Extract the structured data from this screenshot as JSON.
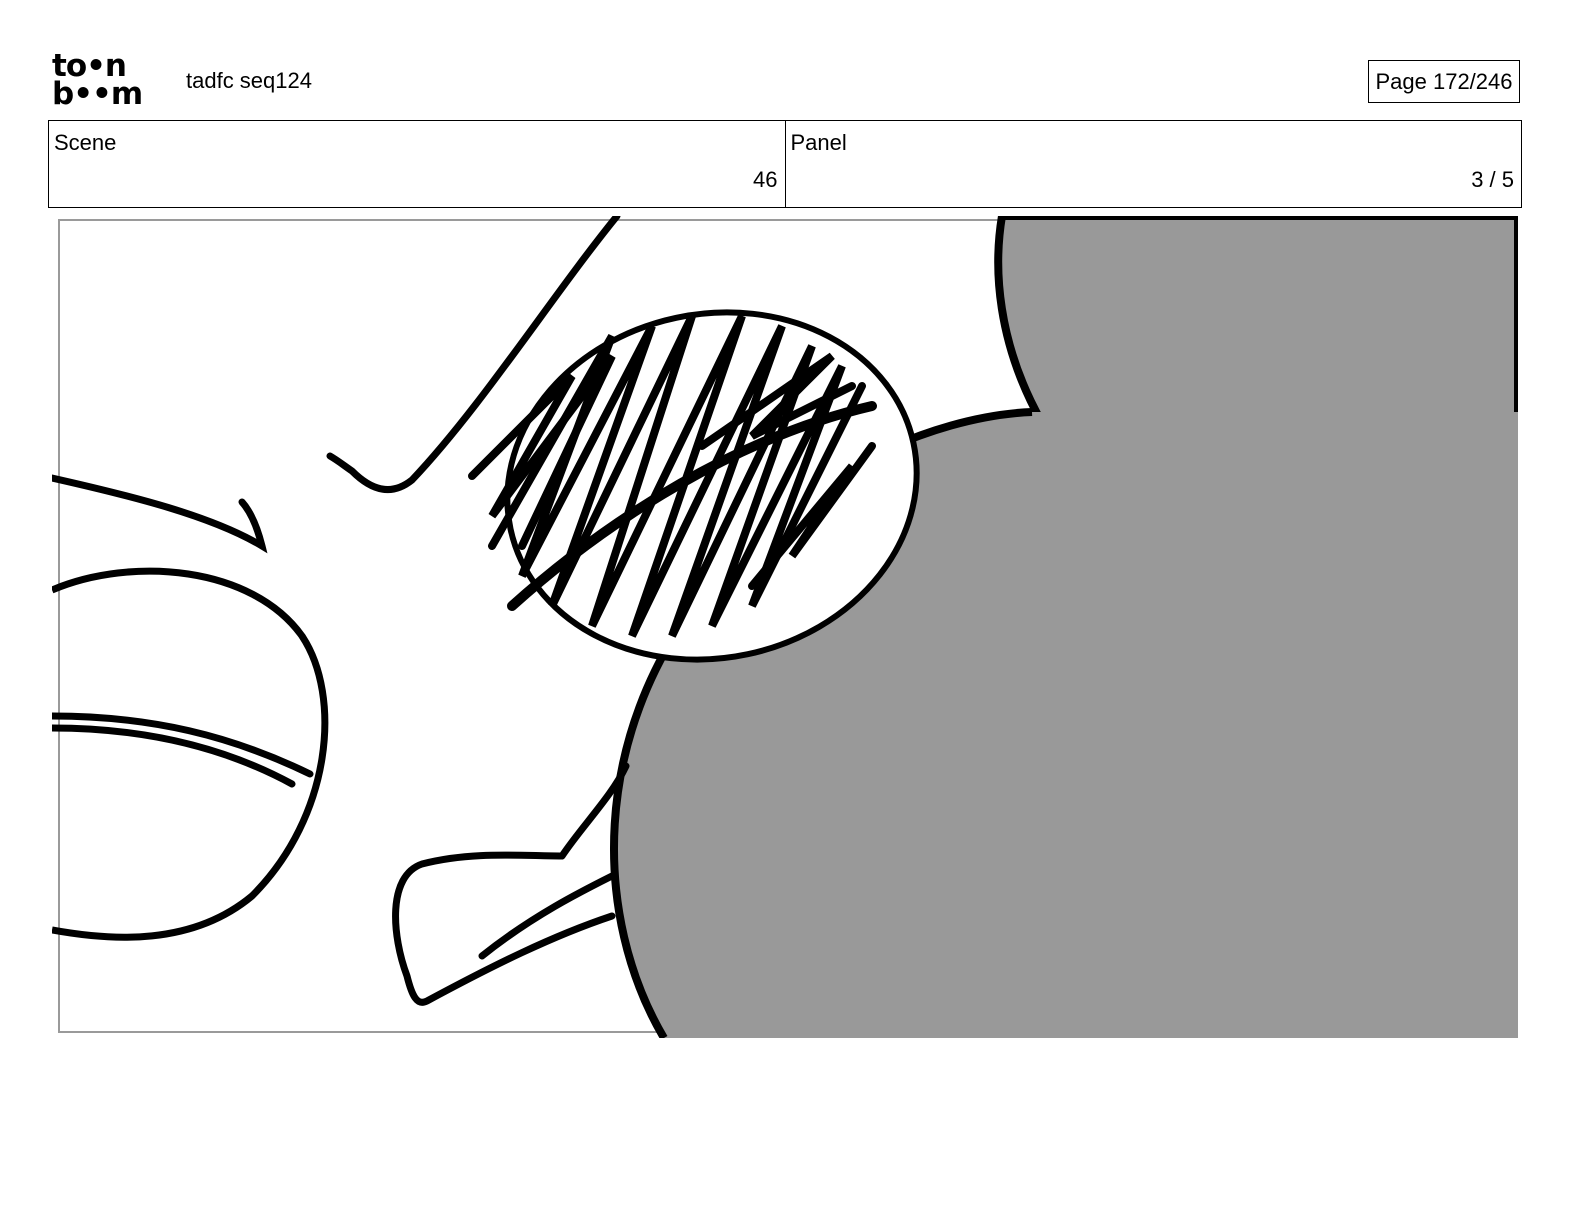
{
  "header": {
    "logo_text_top": "to•n",
    "logo_text_bottom": "b••m",
    "document_title": "tadfc seq124",
    "page_indicator": "Page 172/246"
  },
  "info": {
    "scene_label": "Scene",
    "scene_value": "46",
    "panel_label": "Panel",
    "panel_value": "3 / 5"
  },
  "colors": {
    "fill_gray": "#999999",
    "ink": "#000000"
  }
}
